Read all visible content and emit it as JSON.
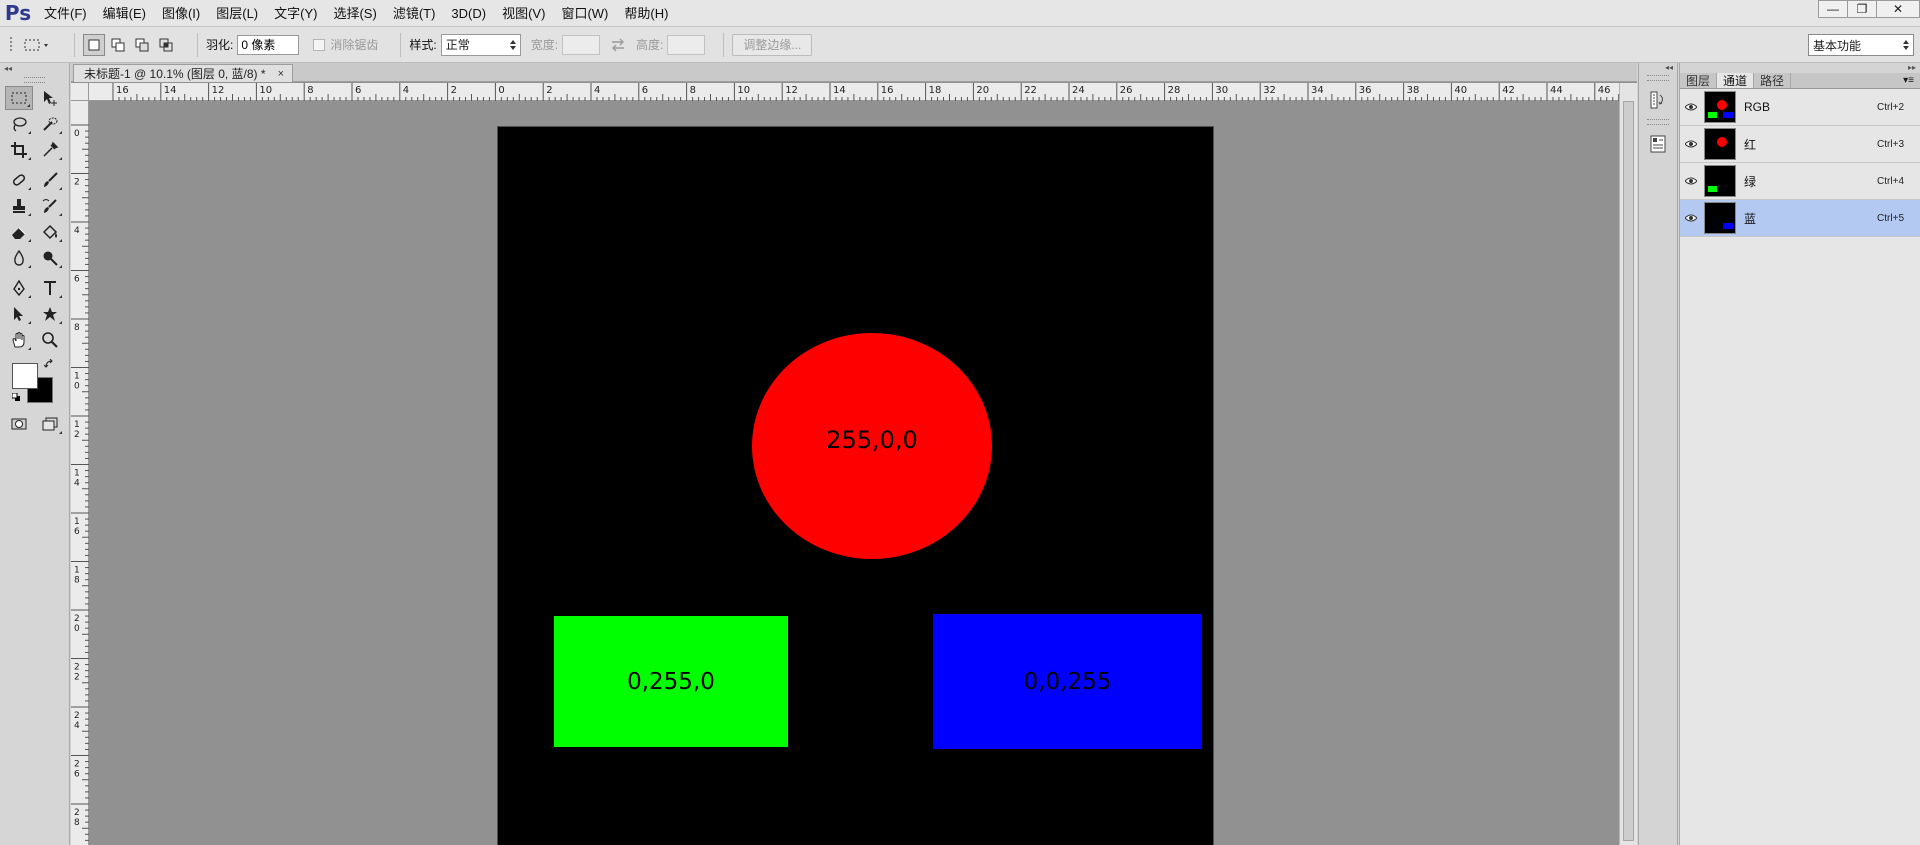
{
  "app": {
    "logo": "Ps",
    "menu": [
      "文件(F)",
      "编辑(E)",
      "图像(I)",
      "图层(L)",
      "文字(Y)",
      "选择(S)",
      "滤镜(T)",
      "3D(D)",
      "视图(V)",
      "窗口(W)",
      "帮助(H)"
    ],
    "window_controls": {
      "minimize": "—",
      "restore": "❐",
      "close": "✕"
    }
  },
  "options_bar": {
    "feather_label": "羽化:",
    "feather_value": "0 像素",
    "antialias_label": "消除锯齿",
    "style_label": "样式:",
    "style_value": "正常",
    "width_label": "宽度:",
    "width_value": "",
    "height_label": "高度:",
    "height_value": "",
    "refine_edge_label": "调整边缘...",
    "workspace_value": "基本功能"
  },
  "document": {
    "tab_title": "未标题-1 @ 10.1% (图层 0, 蓝/8) *",
    "tab_close": "×",
    "h_ruler_labels": [
      "16",
      "14",
      "12",
      "10",
      "8",
      "6",
      "4",
      "2",
      "0",
      "2",
      "4",
      "6",
      "8",
      "10",
      "12",
      "14",
      "16",
      "18",
      "20",
      "22",
      "24",
      "26",
      "28",
      "30",
      "32",
      "34",
      "36",
      "38",
      "40",
      "42",
      "44",
      "46"
    ],
    "v_ruler_labels": [
      "0",
      "2",
      "4",
      "6",
      "8",
      "10",
      "12",
      "14",
      "16",
      "18",
      "20",
      "22",
      "24",
      "26",
      "28"
    ]
  },
  "canvas": {
    "background": "#000000",
    "shapes": {
      "red": {
        "label": "255,0,0",
        "color": "#ff0000"
      },
      "green": {
        "label": "0,255,0",
        "color": "#00ff00"
      },
      "blue": {
        "label": "0,0,255",
        "color": "#0000ff"
      }
    }
  },
  "channels_panel": {
    "tabs": [
      "图层",
      "通道",
      "路径"
    ],
    "active_tab": "通道",
    "channels": [
      {
        "name": "RGB",
        "shortcut": "Ctrl+2",
        "selected": false
      },
      {
        "name": "红",
        "shortcut": "Ctrl+3",
        "selected": false
      },
      {
        "name": "绿",
        "shortcut": "Ctrl+4",
        "selected": false
      },
      {
        "name": "蓝",
        "shortcut": "Ctrl+5",
        "selected": true
      }
    ]
  },
  "colors": {
    "foreground": "#ffffff",
    "background": "#000000",
    "selection_highlight": "#b3c9f2"
  }
}
